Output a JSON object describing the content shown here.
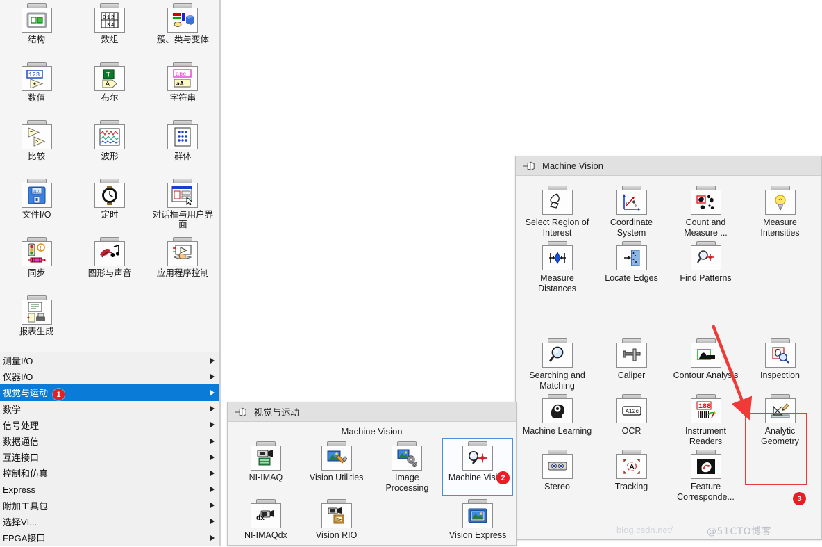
{
  "left_palette": {
    "items": [
      {
        "label": "结构",
        "icon": "structures-icon"
      },
      {
        "label": "数组",
        "icon": "array-icon"
      },
      {
        "label": "簇、类与变体",
        "icon": "cluster-class-variant-icon"
      },
      {
        "label": "数值",
        "icon": "numeric-icon"
      },
      {
        "label": "布尔",
        "icon": "boolean-icon"
      },
      {
        "label": "字符串",
        "icon": "string-icon"
      },
      {
        "label": "比较",
        "icon": "comparison-icon"
      },
      {
        "label": "波形",
        "icon": "waveform-icon"
      },
      {
        "label": "群体",
        "icon": "collection-icon"
      },
      {
        "label": "文件I/O",
        "icon": "file-io-icon"
      },
      {
        "label": "定时",
        "icon": "timing-icon"
      },
      {
        "label": "对话框与用户界面",
        "icon": "dialog-ui-icon"
      },
      {
        "label": "同步",
        "icon": "synchronization-icon"
      },
      {
        "label": "图形与声音",
        "icon": "graphics-sound-icon"
      },
      {
        "label": "应用程序控制",
        "icon": "app-control-icon"
      },
      {
        "label": "报表生成",
        "icon": "report-generation-icon"
      }
    ],
    "menu_items": [
      {
        "label": "测量I/O",
        "selected": false
      },
      {
        "label": "仪器I/O",
        "selected": false
      },
      {
        "label": "视觉与运动",
        "selected": true
      },
      {
        "label": "数学",
        "selected": false
      },
      {
        "label": "信号处理",
        "selected": false
      },
      {
        "label": "数据通信",
        "selected": false
      },
      {
        "label": "互连接口",
        "selected": false
      },
      {
        "label": "控制和仿真",
        "selected": false
      },
      {
        "label": "Express",
        "selected": false
      },
      {
        "label": "附加工具包",
        "selected": false
      },
      {
        "label": "选择VI...",
        "selected": false
      },
      {
        "label": "FPGA接口",
        "selected": false
      }
    ]
  },
  "machine_vision_panel": {
    "title": "Machine Vision",
    "pin_icon": "pin-icon",
    "items": [
      {
        "label": "Select Region of Interest",
        "icon": "select-roi-icon"
      },
      {
        "label": "Coordinate System",
        "icon": "coordinate-system-icon"
      },
      {
        "label": "Count and Measure ...",
        "icon": "count-and-measure-icon"
      },
      {
        "label": "Measure Intensities",
        "icon": "measure-intensities-icon"
      },
      {
        "label": "Measure Distances",
        "icon": "measure-distances-icon"
      },
      {
        "label": "Locate Edges",
        "icon": "locate-edges-icon"
      },
      {
        "label": "Find Patterns",
        "icon": "find-patterns-icon"
      },
      {
        "label": "Searching and Matching",
        "icon": "searching-and-matching-icon"
      },
      {
        "label": "Caliper",
        "icon": "caliper-icon"
      },
      {
        "label": "Contour Analysis",
        "icon": "contour-analysis-icon"
      },
      {
        "label": "Inspection",
        "icon": "inspection-icon"
      },
      {
        "label": "Machine Learning",
        "icon": "machine-learning-icon"
      },
      {
        "label": "OCR",
        "icon": "ocr-icon"
      },
      {
        "label": "Instrument Readers",
        "icon": "instrument-readers-icon"
      },
      {
        "label": "Analytic Geometry",
        "icon": "analytic-geometry-icon"
      },
      {
        "label": "Stereo",
        "icon": "stereo-icon"
      },
      {
        "label": "Tracking",
        "icon": "tracking-icon"
      },
      {
        "label": "Feature Corresponde...",
        "icon": "feature-correspondence-icon"
      }
    ]
  },
  "vision_motion_panel": {
    "title": "视觉与运动",
    "pin_icon": "pin-icon",
    "tooltip": "Machine Vision",
    "items": [
      {
        "label": "NI-IMAQ",
        "icon": "ni-imaq-icon",
        "selected": false
      },
      {
        "label": "Vision Utilities",
        "icon": "vision-utilities-icon",
        "selected": false
      },
      {
        "label": "Image Processing",
        "icon": "image-processing-icon",
        "selected": false
      },
      {
        "label": "Machine Vision",
        "icon": "machine-vision-icon",
        "selected": true
      },
      {
        "label": "NI-IMAQdx",
        "icon": "ni-imaqdx-icon",
        "selected": false
      },
      {
        "label": "Vision RIO",
        "icon": "vision-rio-icon",
        "selected": false
      },
      {
        "label": "",
        "icon": "",
        "selected": false
      },
      {
        "label": "Vision Express",
        "icon": "vision-express-icon",
        "selected": false
      }
    ]
  },
  "annotations": {
    "badge_1": "1",
    "badge_2": "2",
    "badge_3": "3",
    "badge_color": "#ec1c24",
    "highlight_rect_color": "#ef3a38",
    "arrow_color": "#ef3a38",
    "selection_color": "#0a7cd8",
    "watermark": "@51CTO博客",
    "watermark_faint": "blog.csdn.net/"
  }
}
